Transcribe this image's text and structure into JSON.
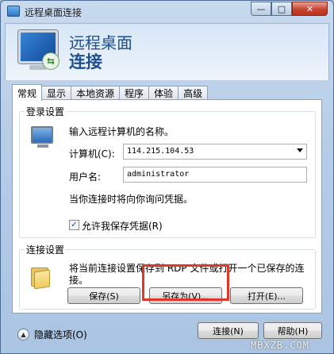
{
  "window": {
    "title": "远程桌面连接"
  },
  "header": {
    "line1": "远程桌面",
    "line2": "连接"
  },
  "tabs": [
    {
      "label": "常规",
      "active": true
    },
    {
      "label": "显示"
    },
    {
      "label": "本地资源"
    },
    {
      "label": "程序"
    },
    {
      "label": "体验"
    },
    {
      "label": "高级"
    }
  ],
  "login": {
    "group_title": "登录设置",
    "instruction": "输入远程计算机的名称。",
    "computer_label": "计算机(C):",
    "computer_value": "114.215.104.53",
    "user_label": "用户名:",
    "user_value": "administrator",
    "hint": "当你连接时将向你询问凭据。",
    "allow_save_label": "允许我保存凭据(R)",
    "allow_save_checked": true
  },
  "connection": {
    "group_title": "连接设置",
    "desc_line1": "将当前连接设置保存到 RDP 文件或打开一个已保存的连",
    "desc_line2": "接。",
    "save_label": "保存(S)",
    "save_as_label": "另存为(V)...",
    "open_label": "打开(E)..."
  },
  "footer": {
    "options_label": "隐藏选项(O)",
    "connect_label": "连接(N)",
    "help_label": "帮助(H)"
  },
  "watermark": "MBXZB.COM",
  "colors": {
    "highlight": "#e0362c",
    "header_text": "#1e4e8c"
  }
}
